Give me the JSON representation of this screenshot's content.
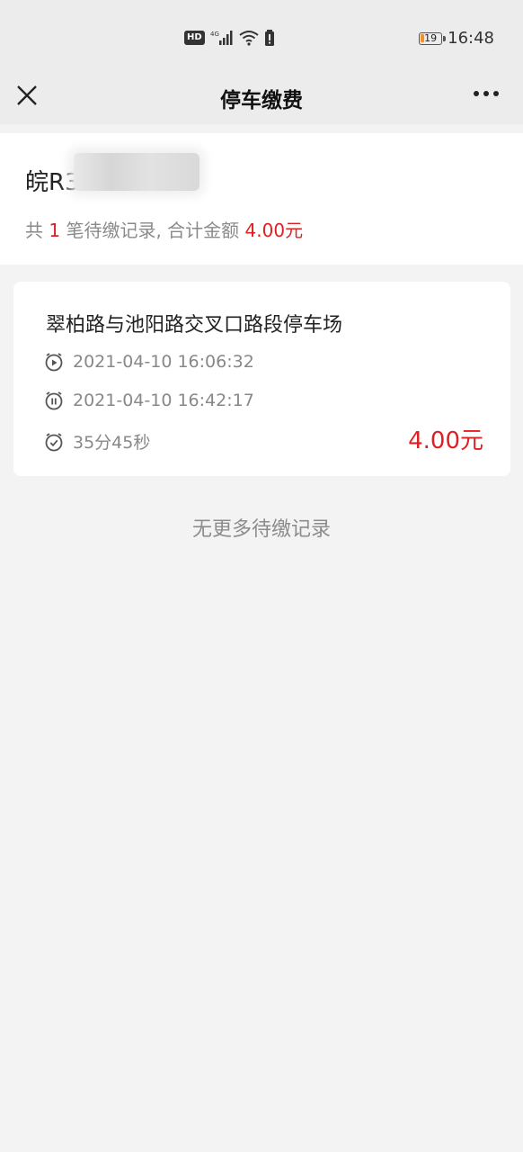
{
  "status_bar": {
    "hd": "HD",
    "network": "4G",
    "battery_level": "19",
    "battery_fraction": 0.19,
    "time": "16:48"
  },
  "nav": {
    "title": "停车缴费",
    "close_icon": "close-icon",
    "more_icon": "more-icon"
  },
  "vehicle": {
    "plate_visible": "皖R3",
    "summary_prefix": "共 ",
    "count": "1",
    "summary_mid": " 笔待缴记录, 合计金额 ",
    "total": "4.00元"
  },
  "records": [
    {
      "lot": "翠柏路与池阳路交叉口路段停车场",
      "start_time": "2021-04-10 16:06:32",
      "end_time": "2021-04-10 16:42:17",
      "duration": "35分45秒",
      "amount": "4.00元"
    }
  ],
  "footer": {
    "no_more": "无更多待缴记录"
  },
  "colors": {
    "accent_red": "#e02020",
    "background": "#f3f3f3"
  }
}
